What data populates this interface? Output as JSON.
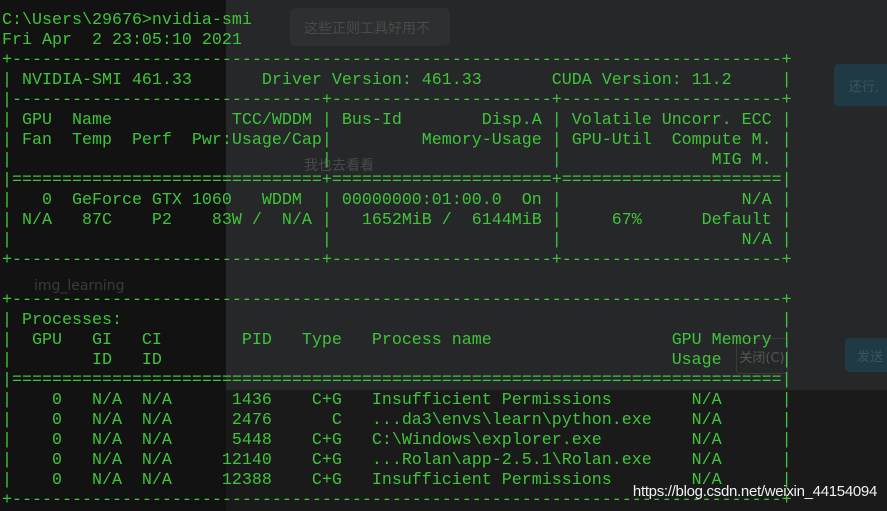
{
  "background": {
    "chat_message_1": "这些正则工具好用不",
    "chat_message_2": "我也去看看",
    "project_name": "img_learning",
    "close_button": "关闭(C)",
    "send_button": "发送",
    "right_button": "还行,"
  },
  "terminal": {
    "text_color": "#3fc43a",
    "lines": [
      "C:\\Users\\29676>nvidia-smi",
      "Fri Apr  2 23:05:10 2021",
      "+-----------------------------------------------------------------------------+",
      "| NVIDIA-SMI 461.33       Driver Version: 461.33       CUDA Version: 11.2     |",
      "|-------------------------------+----------------------+----------------------+",
      "| GPU  Name            TCC/WDDM | Bus-Id        Disp.A | Volatile Uncorr. ECC |",
      "| Fan  Temp  Perf  Pwr:Usage/Cap|         Memory-Usage | GPU-Util  Compute M. |",
      "|                               |                      |               MIG M. |",
      "|===============================+======================+======================|",
      "|   0  GeForce GTX 1060   WDDM  | 00000000:01:00.0  On |                  N/A |",
      "| N/A   87C    P2    83W /  N/A |   1652MiB /  6144MiB |     67%      Default |",
      "|                               |                      |                  N/A |",
      "+-------------------------------+----------------------+----------------------+",
      "",
      "+-----------------------------------------------------------------------------+",
      "| Processes:                                                                  |",
      "|  GPU   GI   CI        PID   Type   Process name                  GPU Memory |",
      "|        ID   ID                                                   Usage      |",
      "|=============================================================================|",
      "|    0   N/A  N/A      1436    C+G   Insufficient Permissions        N/A      |",
      "|    0   N/A  N/A      2476      C   ...da3\\envs\\learn\\python.exe    N/A      |",
      "|    0   N/A  N/A      5448    C+G   C:\\Windows\\explorer.exe         N/A      |",
      "|    0   N/A  N/A     12140    C+G   ...Rolan\\app-2.5.1\\Rolan.exe    N/A      |",
      "|    0   N/A  N/A     12388    C+G   Insufficient Permissions        N/A      |",
      "+-----------------------------------------------------------------------------+"
    ]
  },
  "watermark": "https://blog.csdn.net/weixin_44154094"
}
